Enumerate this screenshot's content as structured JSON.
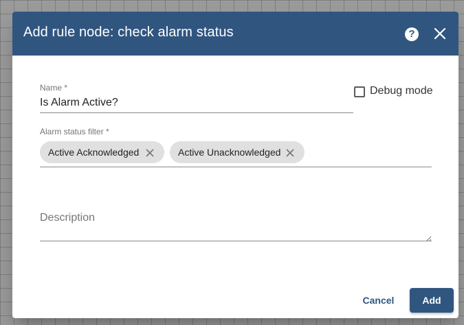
{
  "dialog": {
    "title": "Add rule node: check alarm status",
    "help_icon": "help-circle-icon",
    "close_icon": "close-icon"
  },
  "form": {
    "name": {
      "label": "Name *",
      "value": "Is Alarm Active?"
    },
    "debug_mode": {
      "label": "Debug mode",
      "checked": false
    },
    "alarm_status_filter": {
      "label": "Alarm status filter *",
      "chips": [
        {
          "label": "Active Acknowledged"
        },
        {
          "label": "Active Unacknowledged"
        }
      ]
    },
    "description": {
      "placeholder": "Description",
      "value": ""
    }
  },
  "actions": {
    "cancel_label": "Cancel",
    "add_label": "Add"
  },
  "colors": {
    "primary": "#305680",
    "chip_bg": "#e0e0e0",
    "backdrop": "#9b9b9b"
  }
}
